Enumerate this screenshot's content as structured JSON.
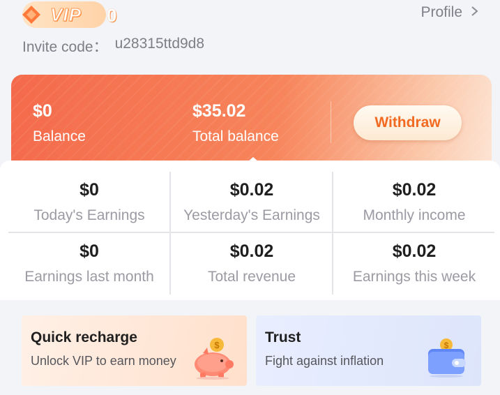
{
  "header": {
    "vip_label": "VIP",
    "vip_level": "0",
    "profile_label": "Profile",
    "invite_label": "Invite code：",
    "invite_code": "u28315ttd9d8"
  },
  "balance_card": {
    "balance_value": "$0",
    "balance_label": "Balance",
    "total_balance_value": "$35.02",
    "total_balance_label": "Total balance",
    "withdraw_label": "Withdraw"
  },
  "stats": [
    {
      "value": "$0",
      "label": "Today's Earnings"
    },
    {
      "value": "$0.02",
      "label": "Yesterday's Earnings"
    },
    {
      "value": "$0.02",
      "label": "Monthly income"
    },
    {
      "value": "$0",
      "label": "Earnings last month"
    },
    {
      "value": "$0.02",
      "label": "Total revenue"
    },
    {
      "value": "$0.02",
      "label": "Earnings this week"
    }
  ],
  "features": [
    {
      "title": "Quick recharge",
      "subtitle": "Unlock VIP to earn money",
      "icon": "piggy-bank-icon"
    },
    {
      "title": "Trust",
      "subtitle": "Fight against inflation",
      "icon": "wallet-icon"
    }
  ],
  "colors": {
    "accent_orange": "#f46a4b",
    "withdraw_text": "#f26a22",
    "page_bg": "#f3f4f8"
  }
}
